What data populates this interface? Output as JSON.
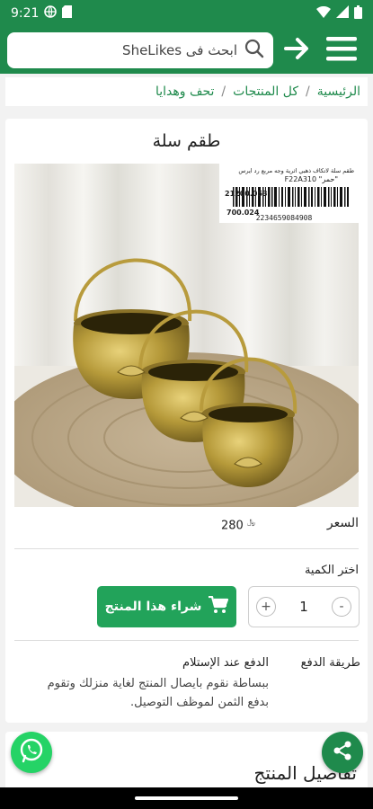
{
  "status_bar": {
    "time": "9:21",
    "icons": [
      "globe-icon",
      "sim-icon",
      "wifi-icon",
      "signal-icon",
      "battery-icon"
    ]
  },
  "app_bar": {
    "search_text": "ابحث فى SheLikes",
    "icons": [
      "search-icon",
      "arrow-right-icon",
      "menu-icon"
    ]
  },
  "breadcrumb": {
    "items": [
      "الرئيسية",
      "كل المنتجات",
      "تحف وهدايا"
    ],
    "separator": "/"
  },
  "product": {
    "title": "طقم سلة",
    "label": {
      "text1": "طقم سلة لاتكاف ذهبي اثرية وجه مربع رد ايرس",
      "text2": "F22A310 \"حمر\"",
      "code1": "21200.053",
      "code2": "700.024",
      "barcode": "2234659084908"
    },
    "price_label": "السعر",
    "price_value": "280",
    "currency_symbol": "﷼",
    "qty_label": "اختر الكمية",
    "qty_value": "1",
    "qty_plus": "+",
    "qty_minus": "-",
    "buy_label": "شراء هذا المنتج",
    "payment_label": "طريقة الدفع",
    "payment_title": "الدفع عند الإستلام",
    "payment_desc": "ببساطة نقوم بايصال المنتج لغاية منزلك وتقوم بدفع الثمن لموظف التوصيل."
  },
  "details": {
    "title": "تفاصيل المنتج"
  },
  "colors": {
    "brand": "#1f8a4c",
    "buy_button": "#22a35a",
    "whatsapp": "#25d366"
  }
}
